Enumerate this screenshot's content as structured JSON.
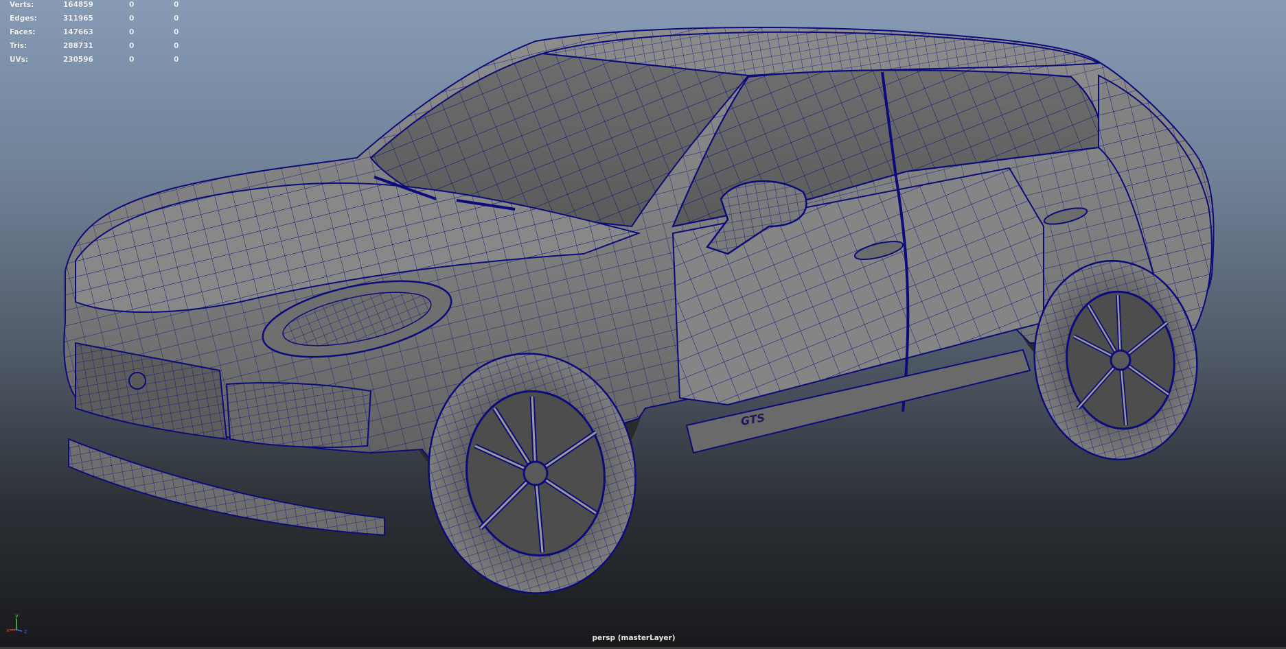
{
  "hud": {
    "rows": [
      {
        "label": "Verts:",
        "value": "164859",
        "selected": "0",
        "component": "0"
      },
      {
        "label": "Edges:",
        "value": "311965",
        "selected": "0",
        "component": "0"
      },
      {
        "label": "Faces:",
        "value": "147663",
        "selected": "0",
        "component": "0"
      },
      {
        "label": "Tris:",
        "value": "288731",
        "selected": "0",
        "component": "0"
      },
      {
        "label": "UVs:",
        "value": "230596",
        "selected": "0",
        "component": "0"
      }
    ]
  },
  "viewport": {
    "camera_label": "persp (masterLayer)",
    "background_top": "#879bb6",
    "background_bottom": "#18191b",
    "wireframe_color": "#0b0b7a",
    "mesh_color": "#7d7d7d"
  },
  "axis_gizmo": {
    "x_label": "x",
    "y_label": "y",
    "z_label": "z",
    "x_color": "#e23b3b",
    "y_color": "#4ed04e",
    "z_color": "#3b6fe2"
  },
  "model": {
    "badge_text": "GTS"
  }
}
